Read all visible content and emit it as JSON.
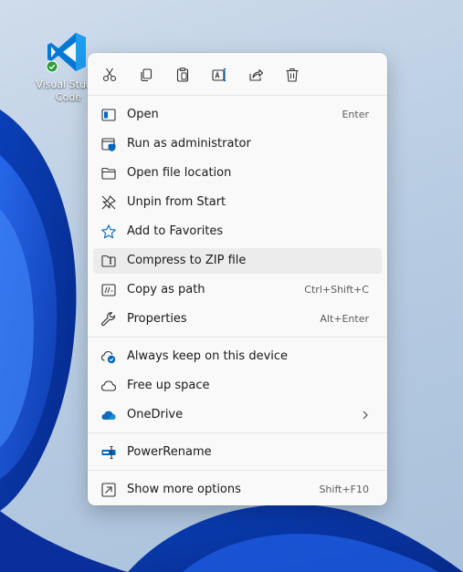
{
  "desktop": {
    "icon_label_line1": "Visual Studio",
    "icon_label_line2": "Code"
  },
  "toolbar": {
    "buttons": [
      {
        "name": "cut",
        "icon": "scissors-icon"
      },
      {
        "name": "copy",
        "icon": "copy-icon"
      },
      {
        "name": "paste",
        "icon": "paste-icon"
      },
      {
        "name": "rename",
        "icon": "rename-icon"
      },
      {
        "name": "share",
        "icon": "share-icon"
      },
      {
        "name": "delete",
        "icon": "trash-icon"
      }
    ]
  },
  "menu": {
    "open": {
      "label": "Open",
      "shortcut": "Enter"
    },
    "run_admin": {
      "label": "Run as administrator"
    },
    "open_location": {
      "label": "Open file location"
    },
    "unpin": {
      "label": "Unpin from Start"
    },
    "favorites": {
      "label": "Add to Favorites"
    },
    "compress": {
      "label": "Compress to ZIP file"
    },
    "copy_path": {
      "label": "Copy as path",
      "shortcut": "Ctrl+Shift+C"
    },
    "properties": {
      "label": "Properties",
      "shortcut": "Alt+Enter"
    },
    "keep_device": {
      "label": "Always keep on this device"
    },
    "free_space": {
      "label": "Free up space"
    },
    "onedrive": {
      "label": "OneDrive"
    },
    "powerrename": {
      "label": "PowerRename"
    },
    "more_options": {
      "label": "Show more options",
      "shortcut": "Shift+F10"
    }
  },
  "colors": {
    "accent": "#0067c0",
    "vscode_blue": "#0078d4",
    "onedrive_blue": "#0f6cbd",
    "menu_bg": "#f9f9f9",
    "hover_bg": "#ececec"
  }
}
